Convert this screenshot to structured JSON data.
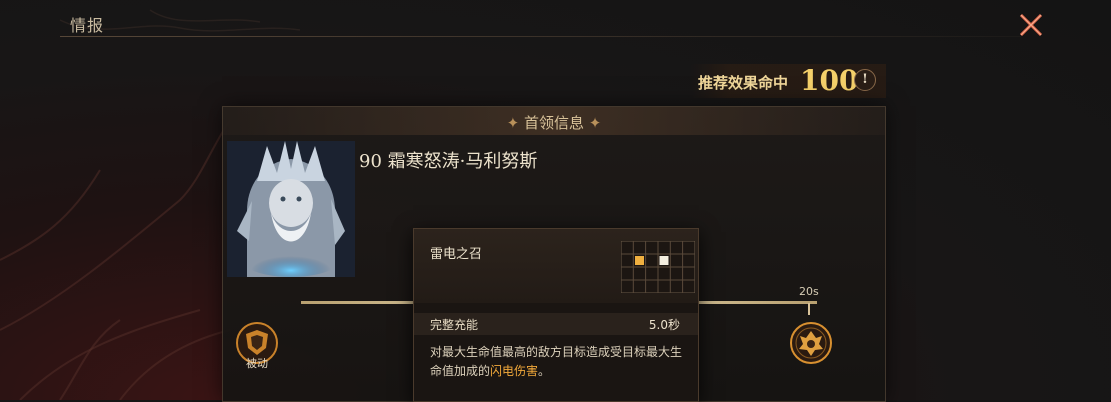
{
  "header": {
    "title": "情报"
  },
  "recommend": {
    "label": "推荐效果命中",
    "value": "100",
    "info_icon": "!"
  },
  "panel": {
    "title": "首领信息"
  },
  "boss": {
    "name": "90 霜寒怒涛·马利努斯"
  },
  "timeline": {
    "time_label": "20s",
    "passive_label": "被动"
  },
  "tooltip": {
    "title": "雷电之召",
    "row_label": "完整充能",
    "row_value": "5.0秒",
    "desc_pre": "对最大生命值最高的敌方目标造成受目标最大生命值加成的",
    "desc_highlight": "闪电伤害",
    "desc_post": "。"
  },
  "colors": {
    "accent": "#f4d06a",
    "highlight": "#f2a93a",
    "text": "#e8dcc4"
  },
  "icons": [
    "close-icon",
    "info-icon",
    "shield-icon",
    "boss-emblem-icon"
  ]
}
